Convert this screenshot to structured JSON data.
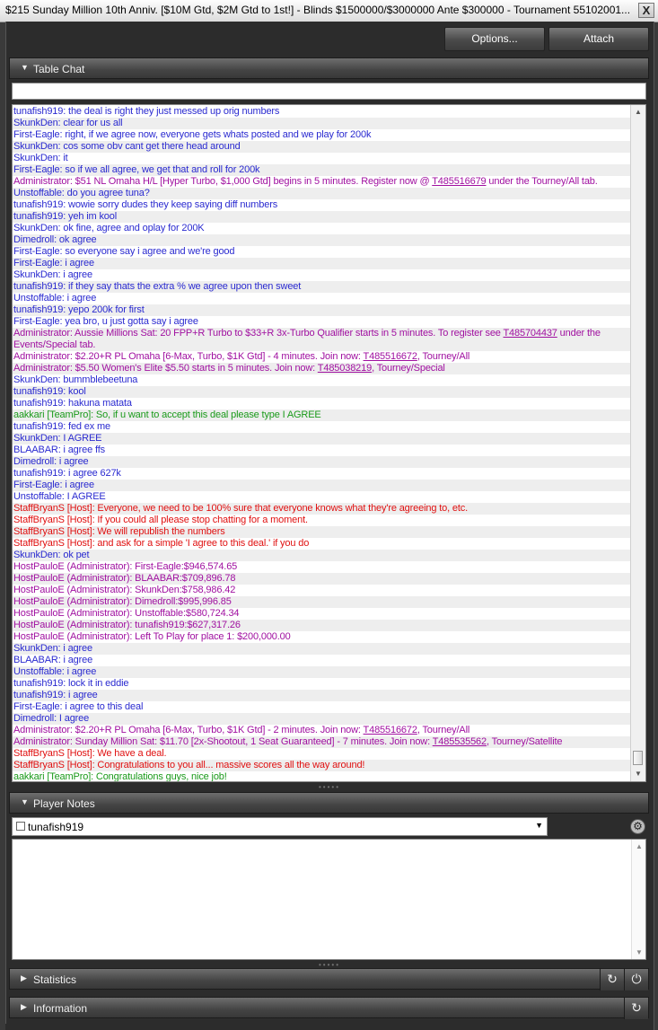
{
  "window": {
    "title": "$215 Sunday Million 10th Anniv. [$10M Gtd, $2M Gtd to 1st!] - Blinds $1500000/$3000000 Ante $300000 - Tournament 55102001...",
    "close_label": "X"
  },
  "toolbar": {
    "options_label": "Options...",
    "attach_label": "Attach"
  },
  "table_chat": {
    "header": "Table Chat",
    "input_value": "",
    "lines": [
      {
        "text": "tunafish919: the deal is right they just messed up orig numbers",
        "color": "#2a2ad0"
      },
      {
        "text": "SkunkDen: clear for us all",
        "color": "#2a2ad0"
      },
      {
        "text": "First-Eagle: right, if we agree now, everyone gets whats posted and we play for 200k",
        "color": "#2a2ad0"
      },
      {
        "text": "SkunkDen: cos some obv cant get there head around",
        "color": "#2a2ad0"
      },
      {
        "text": "SkunkDen: it",
        "color": "#2a2ad0"
      },
      {
        "text": "First-Eagle: so if we all agree, we get that and roll for 200k",
        "color": "#2a2ad0"
      },
      {
        "text": "Administrator: $51 NL Omaha H/L [Hyper Turbo, $1,000 Gtd] begins in 5 minutes.  Register now @ ",
        "link": "T485516679",
        "after": " under the Tourney/All tab.",
        "color": "#a010a0"
      },
      {
        "text": "Unstoffable: do you agree tuna?",
        "color": "#2a2ad0"
      },
      {
        "text": "tunafish919: wowie sorry dudes they keep saying diff numbers",
        "color": "#2a2ad0"
      },
      {
        "text": "tunafish919: yeh im kool",
        "color": "#2a2ad0"
      },
      {
        "text": "SkunkDen: ok fine, agree and oplay for 200K",
        "color": "#2a2ad0"
      },
      {
        "text": "Dimedroll: ok agree",
        "color": "#2a2ad0"
      },
      {
        "text": "First-Eagle: so everyone say i agree and we're good",
        "color": "#2a2ad0"
      },
      {
        "text": "First-Eagle: i agree",
        "color": "#2a2ad0"
      },
      {
        "text": "SkunkDen: i agree",
        "color": "#2a2ad0"
      },
      {
        "text": "tunafish919: if they say thats the extra % we agree upon then sweet",
        "color": "#2a2ad0"
      },
      {
        "text": "Unstoffable: i agree",
        "color": "#2a2ad0"
      },
      {
        "text": "tunafish919: yepo 200k for first",
        "color": "#2a2ad0"
      },
      {
        "text": "First-Eagle: yea bro, u just gotta say i agree",
        "color": "#2a2ad0"
      },
      {
        "text": "Administrator: Aussie Millions Sat: 20 FPP+R Turbo to $33+R 3x-Turbo Qualifier starts in 5 minutes. To register see ",
        "link": "T485704437",
        "after": " under the Events/Special tab.",
        "color": "#a010a0",
        "wrap": true
      },
      {
        "text": "Administrator: $2.20+R PL Omaha [6-Max, Turbo, $1K Gtd] - 4 minutes.  Join now: ",
        "link": "T485516672",
        "after": ", Tourney/All",
        "color": "#a010a0"
      },
      {
        "text": "Administrator: $5.50 Women's Elite $5.50 starts in 5 minutes.  Join now: ",
        "link": "T485038219",
        "after": ", Tourney/Special",
        "color": "#a010a0"
      },
      {
        "text": "SkunkDen: bummblebeetuna",
        "color": "#2a2ad0"
      },
      {
        "text": "tunafish919: kool",
        "color": "#2a2ad0"
      },
      {
        "text": "tunafish919: hakuna matata",
        "color": "#2a2ad0"
      },
      {
        "text": "aakkari [TeamPro]: So, if u want to accept this deal please type I AGREE",
        "color": "#1a9a1a"
      },
      {
        "text": "tunafish919: fed ex me",
        "color": "#2a2ad0"
      },
      {
        "text": "SkunkDen: I AGREE",
        "color": "#2a2ad0"
      },
      {
        "text": "BLAABAR: i agree ffs",
        "color": "#2a2ad0"
      },
      {
        "text": "Dimedroll: i agree",
        "color": "#2a2ad0"
      },
      {
        "text": "tunafish919: i agree 627k",
        "color": "#2a2ad0"
      },
      {
        "text": "First-Eagle: i agree",
        "color": "#2a2ad0"
      },
      {
        "text": "Unstoffable: I AGREE",
        "color": "#2a2ad0"
      },
      {
        "text": "StaffBryanS [Host]: Everyone, we need to be 100% sure that everyone knows what they're agreeing to, etc.",
        "color": "#e01010"
      },
      {
        "text": "StaffBryanS [Host]: If you could all please stop chatting for a moment.",
        "color": "#e01010"
      },
      {
        "text": "StaffBryanS [Host]: We will republish the numbers",
        "color": "#e01010"
      },
      {
        "text": "StaffBryanS [Host]: and ask for a simple 'I agree to this deal.' if you do",
        "color": "#e01010"
      },
      {
        "text": "SkunkDen: ok pet",
        "color": "#2a2ad0"
      },
      {
        "text": "HostPauloE (Administrator): First-Eagle:$946,574.65",
        "color": "#a010a0"
      },
      {
        "text": "HostPauloE (Administrator): BLAABAR:$709,896.78",
        "color": "#a010a0"
      },
      {
        "text": "HostPauloE (Administrator): SkunkDen:$758,986.42",
        "color": "#a010a0"
      },
      {
        "text": "HostPauloE (Administrator): Dimedroll:$995,996.85",
        "color": "#a010a0"
      },
      {
        "text": "HostPauloE (Administrator): Unstoffable:$580,724.34",
        "color": "#a010a0"
      },
      {
        "text": "HostPauloE (Administrator): tunafish919:$627,317.26",
        "color": "#a010a0"
      },
      {
        "text": "HostPauloE (Administrator): Left To Play for place 1: $200,000.00",
        "color": "#a010a0"
      },
      {
        "text": "SkunkDen: i agree",
        "color": "#2a2ad0"
      },
      {
        "text": "BLAABAR: i agree",
        "color": "#2a2ad0"
      },
      {
        "text": "Unstoffable: i agree",
        "color": "#2a2ad0"
      },
      {
        "text": "tunafish919: lock it in eddie",
        "color": "#2a2ad0"
      },
      {
        "text": "tunafish919: i agree",
        "color": "#2a2ad0"
      },
      {
        "text": "First-Eagle: i agree to this deal",
        "color": "#2a2ad0"
      },
      {
        "text": "Dimedroll: I agree",
        "color": "#2a2ad0"
      },
      {
        "text": "Administrator: $2.20+R PL Omaha [6-Max, Turbo, $1K Gtd] - 2 minutes.  Join now: ",
        "link": "T485516672",
        "after": ", Tourney/All",
        "color": "#a010a0"
      },
      {
        "text": "Administrator: Sunday Million Sat: $11.70 [2x-Shootout, 1 Seat Guaranteed] - 7 minutes.  Join now: ",
        "link": "T485535562",
        "after": ", Tourney/Satellite",
        "color": "#a010a0"
      },
      {
        "text": "StaffBryanS [Host]: We have a deal.",
        "color": "#e01010"
      },
      {
        "text": "StaffBryanS [Host]: Congratulations to you all... massive scores all the way around!",
        "color": "#e01010"
      },
      {
        "text": "aakkari [TeamPro]: Congratulations guys, nice job!",
        "color": "#1a9a1a"
      }
    ]
  },
  "player_notes": {
    "header": "Player Notes",
    "selected_player": "tunafish919",
    "note_text": ""
  },
  "statistics": {
    "header": "Statistics"
  },
  "information": {
    "header": "Information"
  },
  "icons": {
    "collapse": "▼",
    "expand": "▶",
    "dropdown": "▼",
    "scroll_up": "▲",
    "scroll_down": "▼",
    "gear": "⚙",
    "refresh": "↻",
    "power": "⏻",
    "grip": "•••••"
  }
}
